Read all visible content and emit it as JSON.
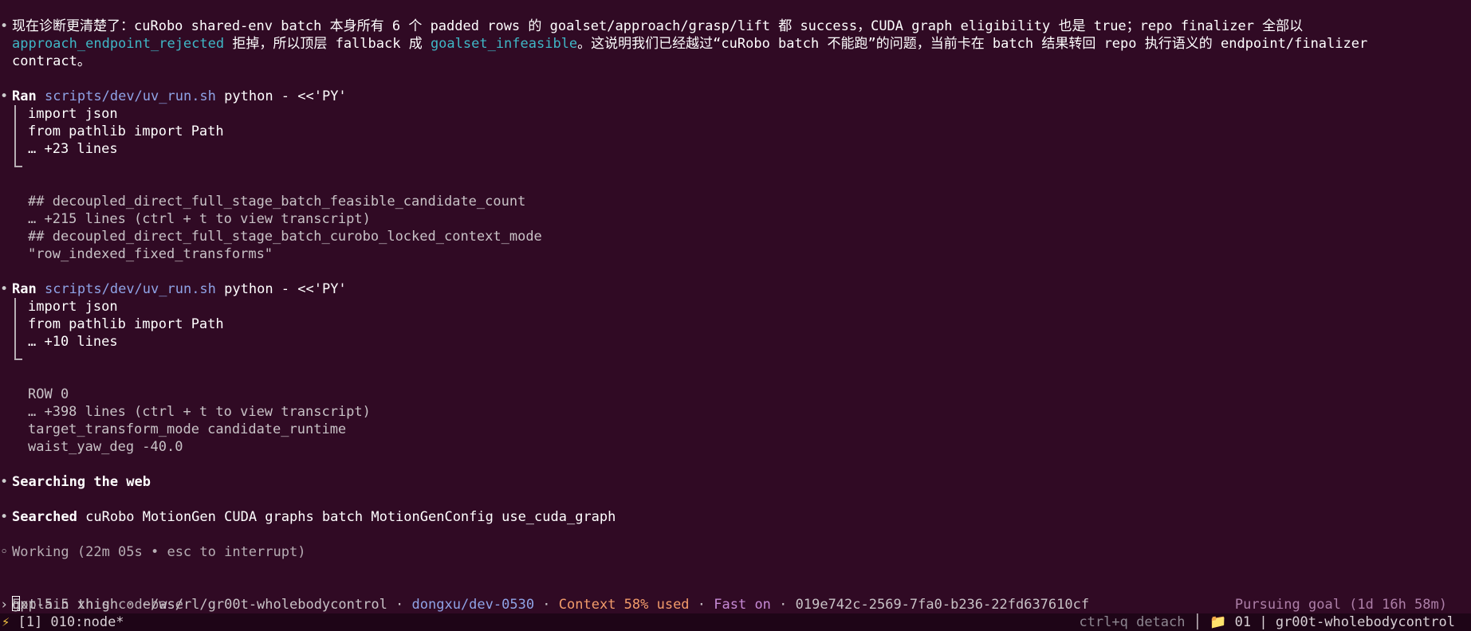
{
  "message": {
    "line1": "现在诊断更清楚了：cuRobo shared-env batch 本身所有 6 个 padded rows 的 goalset/approach/grasp/lift 都 success，CUDA graph eligibility 也是 true；repo finalizer 全部以",
    "line2_token1": "approach_endpoint_rejected",
    "line2_mid": " 拒掉，所以顶层 fallback 成 ",
    "line2_token2": "goalset_infeasible",
    "line2_end": "。这说明我们已经越过“cuRobo batch 不能跑”的问题，当前卡在 batch 结果转回 repo 执行语义的 endpoint/finalizer",
    "line3": "contract。"
  },
  "ran1": {
    "label": "Ran",
    "script": "scripts/dev/uv_run.sh",
    "args": " python - <<'PY'",
    "code": [
      "import json",
      "from pathlib import Path",
      "… +23 lines"
    ],
    "output": [
      "## decoupled_direct_full_stage_batch_feasible_candidate_count",
      "… +215 lines (ctrl + t to view transcript)",
      "## decoupled_direct_full_stage_batch_curobo_locked_context_mode",
      "\"row_indexed_fixed_transforms\""
    ]
  },
  "ran2": {
    "label": "Ran",
    "script": "scripts/dev/uv_run.sh",
    "args": " python - <<'PY'",
    "code": [
      "import json",
      "from pathlib import Path",
      "… +10 lines"
    ],
    "output": [
      "ROW 0",
      "… +398 lines (ctrl + t to view transcript)",
      "target_transform_mode candidate_runtime",
      "waist_yaw_deg -40.0"
    ]
  },
  "searching": "Searching the web",
  "searched": {
    "label": "Searched",
    "query": " cuRobo MotionGen CUDA graphs batch MotionGenConfig use_cuda_graph"
  },
  "working": "Working (22m 05s • esc to interrupt)",
  "prompt": {
    "placeholder": "Explain this codebase"
  },
  "statusbar": {
    "model": "gpt-5.5 xhigh",
    "dir": " · ~/ws/rl/gr00t-wholebodycontrol · ",
    "branch": "dongxu/dev-0530",
    "sep1": " · ",
    "context": "Context 58% used",
    "sep2": " · ",
    "fast": "Fast on",
    "session": " · 019e742c-2569-7fa0-b236-22fd637610cf",
    "goal": "Pursuing goal (1d 16h 58m)"
  },
  "tmux": {
    "window": " [1] 010:node*",
    "detach": "ctrl+q detach",
    "session": " 01 | gr00t-wholebodycontrol"
  },
  "colors": {
    "background": "#300a24",
    "cyan_token": "#3fb7c6",
    "path": "#8fa3e6",
    "orange": "#f29b6a",
    "purple": "#c78ad6"
  }
}
